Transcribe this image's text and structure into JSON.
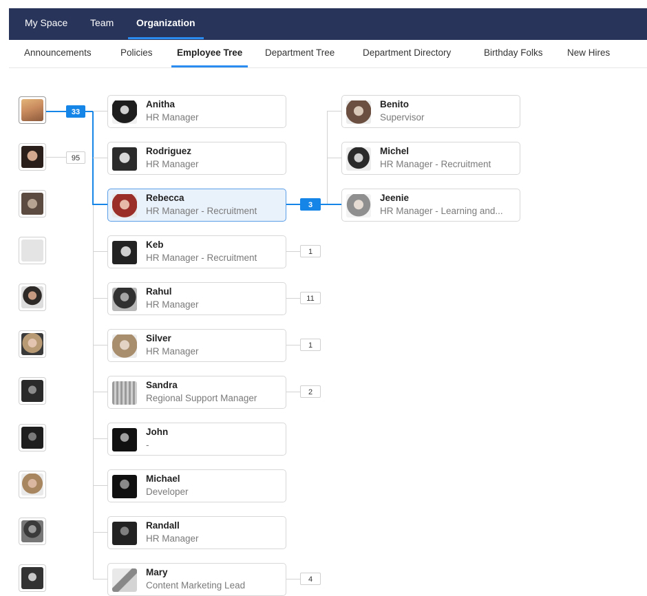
{
  "top_tabs": [
    {
      "label": "My Space",
      "active": false
    },
    {
      "label": "Team",
      "active": false
    },
    {
      "label": "Organization",
      "active": true
    }
  ],
  "sub_tabs": [
    {
      "label": "Announcements",
      "active": false
    },
    {
      "label": "Policies",
      "active": false
    },
    {
      "label": "Employee Tree",
      "active": true
    },
    {
      "label": "Department Tree",
      "active": false
    },
    {
      "label": "Department Directory",
      "active": false
    },
    {
      "label": "Birthday Folks",
      "active": false
    },
    {
      "label": "New Hires",
      "active": false
    }
  ],
  "colors": {
    "nav_bg": "#283459",
    "accent": "#1685e8",
    "selected_card": "#e9f1fb"
  },
  "root_column": {
    "counts": [
      "33",
      "95"
    ],
    "avatars": [
      "avatar-blonde-woman",
      "avatar-dark-hair-woman",
      "avatar-curly-hair-woman",
      "avatar-placeholder",
      "avatar-bearded-man",
      "avatar-blonde-woman-2",
      "avatar-woman-dark",
      "avatar-man-dark",
      "avatar-woman-smiling",
      "avatar-man-suit",
      "avatar-man-glasses"
    ]
  },
  "employees": [
    {
      "name": "Anitha",
      "role": "HR Manager",
      "count": ""
    },
    {
      "name": "Rodriguez",
      "role": "HR Manager",
      "count": ""
    },
    {
      "name": "Rebecca",
      "role": "HR Manager - Recruitment",
      "count": "3",
      "selected": true
    },
    {
      "name": "Keb",
      "role": "HR Manager - Recruitment",
      "count": "1"
    },
    {
      "name": "Rahul",
      "role": "HR Manager",
      "count": "11"
    },
    {
      "name": "Silver",
      "role": "HR Manager",
      "count": "1"
    },
    {
      "name": "Sandra",
      "role": "Regional Support Manager",
      "count": "2"
    },
    {
      "name": "John",
      "role": "-",
      "count": ""
    },
    {
      "name": "Michael",
      "role": "Developer",
      "count": ""
    },
    {
      "name": "Randall",
      "role": "HR Manager",
      "count": ""
    },
    {
      "name": "Mary",
      "role": "Content Marketing Lead",
      "count": "4"
    }
  ],
  "reports": [
    {
      "name": "Benito",
      "role": "Supervisor"
    },
    {
      "name": "Michel",
      "role": "HR Manager - Recruitment"
    },
    {
      "name": "Jeenie",
      "role": "HR Manager - Learning and..."
    }
  ]
}
